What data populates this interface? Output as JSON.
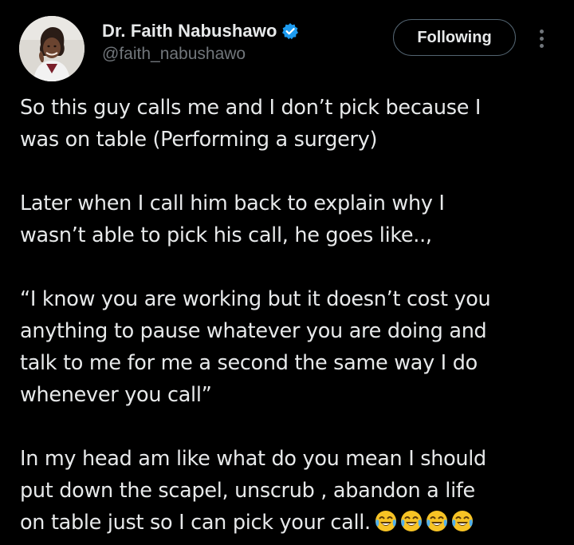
{
  "author": {
    "display_name": "Dr. Faith Nabushawo",
    "handle": "@faith_nabushawo",
    "verified": true
  },
  "actions": {
    "follow_label": "Following"
  },
  "tweet": {
    "paragraphs": [
      "So this guy calls me and I don’t pick because I\nwas on table (Performing a surgery)",
      "Later when I call him back to explain why I\nwasn’t able to pick his call, he goes like..,",
      "“I know you are working but it doesn’t cost you\nanything to pause whatever you are doing and\ntalk to me for me a second the same way I do\nwhenever you call”",
      "In my head am like what do you mean I should\nput down the scapel, unscrub , abandon a life\non table just so I can pick your call."
    ],
    "trailing_emoji": [
      "face-with-tears-of-joy",
      "face-with-tears-of-joy",
      "face-with-tears-of-joy",
      "face-with-tears-of-joy"
    ]
  },
  "colors": {
    "background": "#000000",
    "text_primary": "#e7e9ea",
    "text_secondary": "#71767b",
    "verified_blue": "#1d9bf0",
    "button_border": "#536471"
  }
}
